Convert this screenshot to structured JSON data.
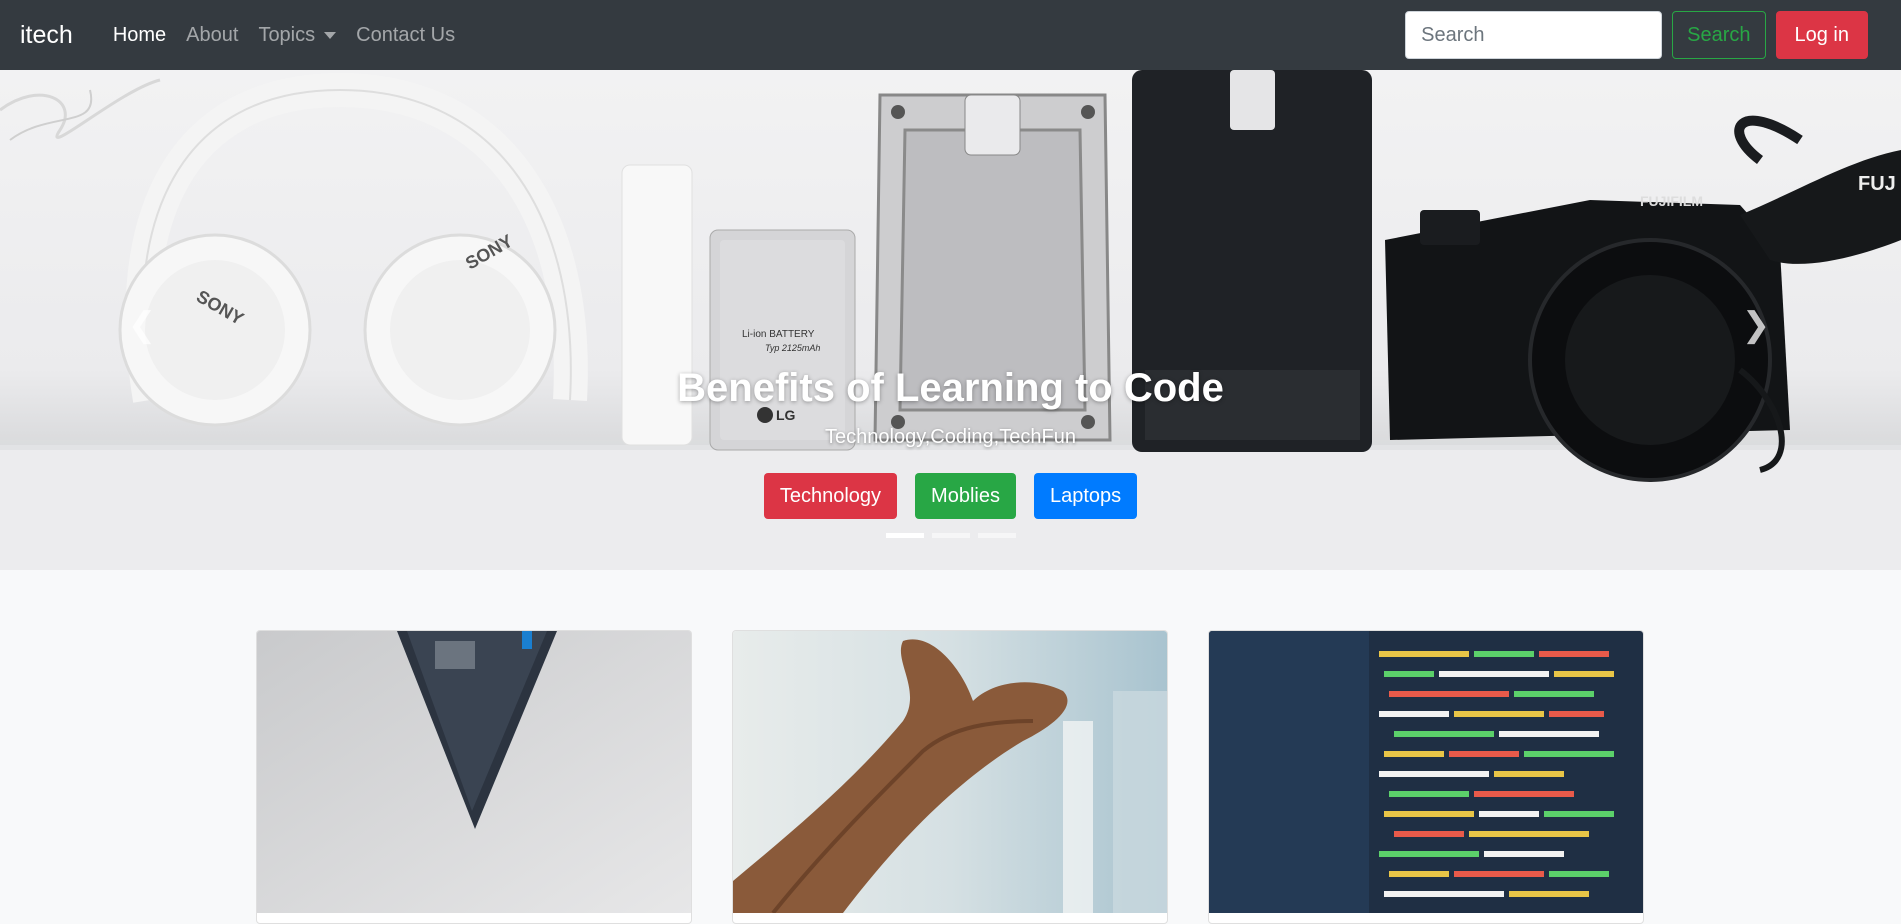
{
  "navbar": {
    "brand": "itech",
    "links": [
      {
        "label": "Home",
        "active": true
      },
      {
        "label": "About",
        "active": false
      },
      {
        "label": "Topics",
        "active": false,
        "dropdown": true
      },
      {
        "label": "Contact Us",
        "active": false
      }
    ],
    "search_placeholder": "Search",
    "search_button": "Search",
    "login_button": "Log in"
  },
  "carousel": {
    "title": "Benefits of Learning to Code",
    "subtitle": "Technology,Coding,TechFun",
    "buttons": [
      {
        "label": "Technology",
        "color": "#dc3545"
      },
      {
        "label": "Moblies",
        "color": "#28a745"
      },
      {
        "label": "Laptops",
        "color": "#007bff"
      }
    ],
    "image_text": {
      "brand_left": "SONY",
      "brand_right": "SONY",
      "battery": "Li-ion BATTERY",
      "battery_spec": "Typ 2125mAh",
      "battery_brand": "LG",
      "camera_brand": "FUJIFILM",
      "strap_text": "FUJ"
    },
    "indicators": 3,
    "active_indicator": 0
  },
  "cards": [
    {
      "image": "tablet-on-white-surface"
    },
    {
      "image": "open-hand"
    },
    {
      "image": "code-on-screen"
    }
  ],
  "colors": {
    "navbar_bg": "#343a40",
    "body_bg": "#f8f9fa",
    "danger": "#dc3545",
    "success": "#28a745",
    "primary": "#007bff"
  }
}
